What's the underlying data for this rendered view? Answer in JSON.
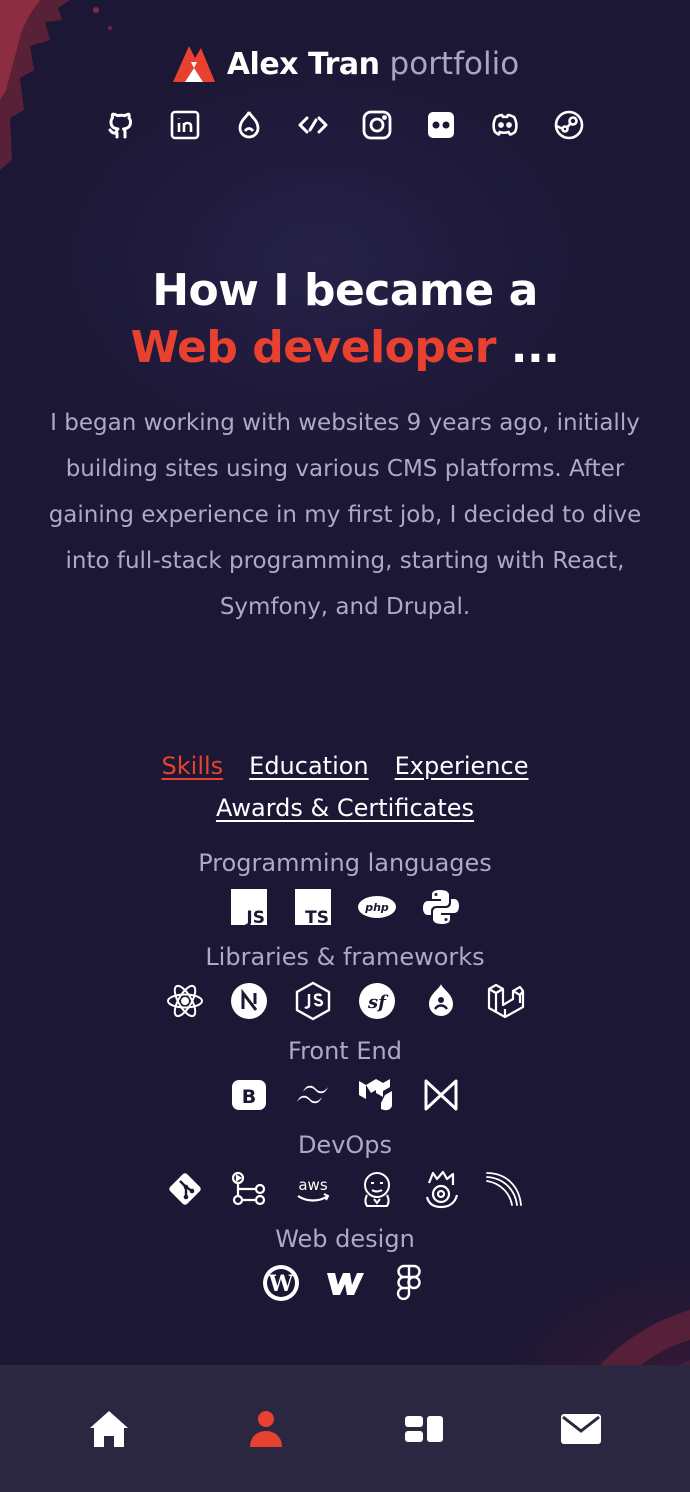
{
  "colors": {
    "background": "#1b1734",
    "accent": "#e9412f",
    "muted": "#aeaac4",
    "nav_bg": "#2b2741"
  },
  "header": {
    "logo_icon": "fox-logo-icon",
    "name": "Alex Tran",
    "subtitle": "portfolio",
    "socials": [
      {
        "icon": "github-icon"
      },
      {
        "icon": "linkedin-icon"
      },
      {
        "icon": "drupal-icon"
      },
      {
        "icon": "stackexchange-icon"
      },
      {
        "icon": "instagram-icon"
      },
      {
        "icon": "flickr-icon"
      },
      {
        "icon": "discord-icon"
      },
      {
        "icon": "steam-icon"
      }
    ]
  },
  "hero": {
    "line1": "How I became a",
    "accent": "Web developer",
    "dots": " ...",
    "intro": "I began working with websites 9 years ago, initially building sites using various CMS platforms. After gaining experience in my first job, I decided to dive into full-stack programming, starting with React, Symfony, and Drupal."
  },
  "tabs": [
    {
      "label": "Skills",
      "active": true
    },
    {
      "label": "Education",
      "active": false
    },
    {
      "label": "Experience",
      "active": false
    },
    {
      "label": "Awards & Certificates",
      "active": false
    }
  ],
  "skills": [
    {
      "title": "Programming languages",
      "icons": [
        "javascript-icon",
        "typescript-icon",
        "php-icon",
        "python-icon"
      ]
    },
    {
      "title": "Libraries & frameworks",
      "icons": [
        "react-icon",
        "nextjs-icon",
        "nodejs-icon",
        "symfony-icon",
        "drupal-icon",
        "laravel-icon"
      ]
    },
    {
      "title": "Front End",
      "icons": [
        "bootstrap-icon",
        "tailwind-icon",
        "mui-icon",
        "mantine-icon"
      ]
    },
    {
      "title": "DevOps",
      "icons": [
        "git-icon",
        "github-actions-icon",
        "aws-icon",
        "jenkins-icon",
        "kubernetes-helm-icon",
        "railway-icon"
      ]
    },
    {
      "title": "Web design",
      "icons": [
        "wordpress-icon",
        "webflow-icon",
        "figma-icon"
      ]
    }
  ],
  "bottom_nav": [
    {
      "icon": "home-icon",
      "active": false
    },
    {
      "icon": "user-icon",
      "active": true
    },
    {
      "icon": "projects-grid-icon",
      "active": false
    },
    {
      "icon": "mail-icon",
      "active": false
    }
  ]
}
